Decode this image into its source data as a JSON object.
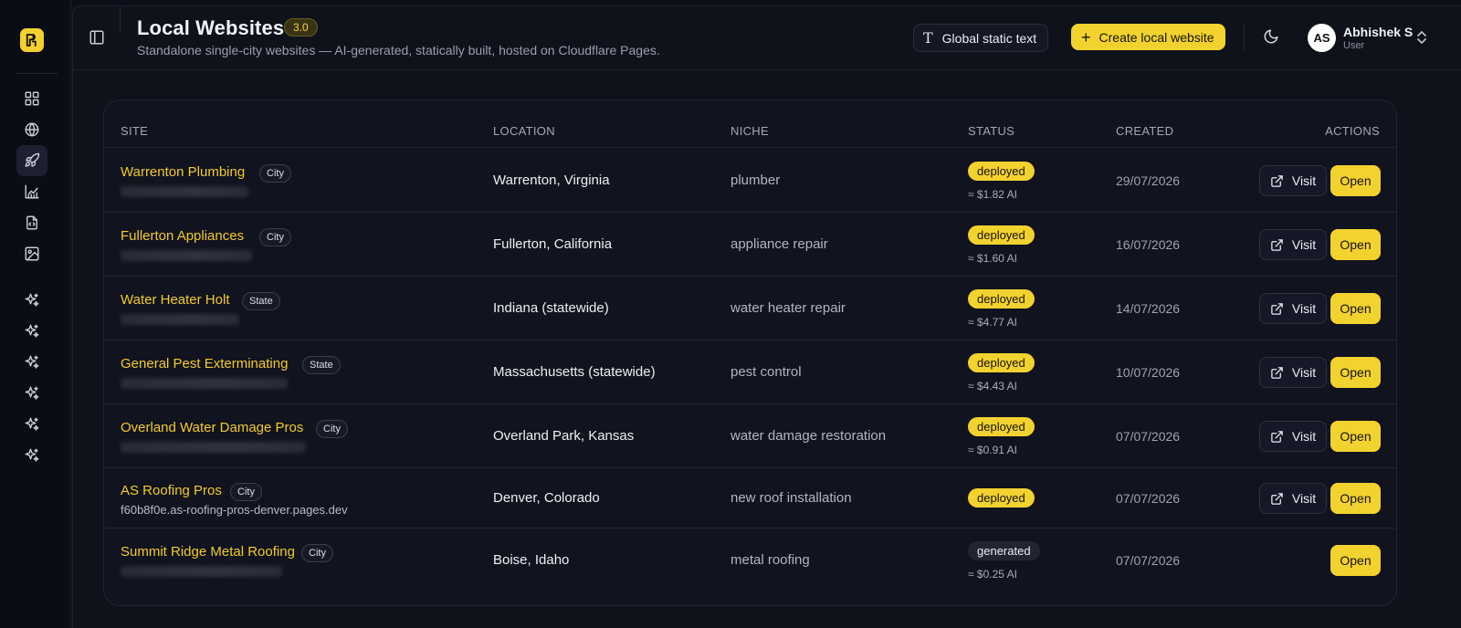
{
  "app": {
    "title": "Local Websites",
    "version": "3.0",
    "subtitle": "Standalone single-city websites — AI-generated, statically built, hosted on Cloudflare Pages."
  },
  "colors": {
    "accent": "#f2d22e",
    "background": "#0c0e17"
  },
  "sidebar": {
    "logo_icon": "brand-logo-icon",
    "items": [
      {
        "icon": "dashboard-grid-icon"
      },
      {
        "icon": "globe-icon"
      },
      {
        "icon": "rocket-icon",
        "active": true
      },
      {
        "icon": "analytics-chart-icon"
      },
      {
        "icon": "code-file-icon"
      },
      {
        "icon": "image-icon"
      },
      {
        "icon": "sparkles-icon"
      },
      {
        "icon": "sparkles-icon"
      },
      {
        "icon": "sparkles-icon"
      },
      {
        "icon": "sparkles-icon"
      },
      {
        "icon": "sparkles-icon"
      },
      {
        "icon": "sparkles-icon"
      }
    ]
  },
  "header": {
    "global_static_text_label": "Global static text",
    "create_label": "Create local website",
    "user": {
      "initials": "AS",
      "name": "Abhishek S",
      "role": "User"
    }
  },
  "table": {
    "columns": {
      "site": "SITE",
      "location": "LOCATION",
      "niche": "NICHE",
      "status": "STATUS",
      "created": "CREATED",
      "actions": "ACTIONS"
    },
    "visit_label": "Visit",
    "open_label": "Open",
    "rows": [
      {
        "name": "Warrenton Plumbing",
        "scope": "City",
        "url": "",
        "location": "Warrenton, Virginia",
        "niche": "plumber",
        "status": "deployed",
        "cost": "≈ $1.82 AI",
        "created": "29/07/2026",
        "visit": true
      },
      {
        "name": "Fullerton Appliances",
        "scope": "City",
        "url": "",
        "location": "Fullerton, California",
        "niche": "appliance repair",
        "status": "deployed",
        "cost": "≈ $1.60 AI",
        "created": "16/07/2026",
        "visit": true
      },
      {
        "name": "Water Heater Holt",
        "scope": "State",
        "url": "",
        "location": "Indiana (statewide)",
        "niche": "water heater repair",
        "status": "deployed",
        "cost": "≈ $4.77 AI",
        "created": "14/07/2026",
        "visit": true
      },
      {
        "name": "General Pest Exterminating",
        "scope": "State",
        "url": "",
        "location": "Massachusetts (statewide)",
        "niche": "pest control",
        "status": "deployed",
        "cost": "≈ $4.43 AI",
        "created": "10/07/2026",
        "visit": true
      },
      {
        "name": "Overland Water Damage Pros",
        "scope": "City",
        "url": "",
        "location": "Overland Park, Kansas",
        "niche": "water damage restoration",
        "status": "deployed",
        "cost": "≈ $0.91 AI",
        "created": "07/07/2026",
        "visit": true
      },
      {
        "name": "AS Roofing Pros",
        "scope": "City",
        "url": "f60b8f0e.as-roofing-pros-denver.pages.dev",
        "location": "Denver, Colorado",
        "niche": "new roof installation",
        "status": "deployed",
        "cost": "",
        "created": "07/07/2026",
        "visit": true
      },
      {
        "name": "Summit Ridge Metal Roofing",
        "scope": "City",
        "url": "",
        "location": "Boise, Idaho",
        "niche": "metal roofing",
        "status": "generated",
        "cost": "≈ $0.25 AI",
        "created": "07/07/2026",
        "visit": false
      }
    ]
  }
}
